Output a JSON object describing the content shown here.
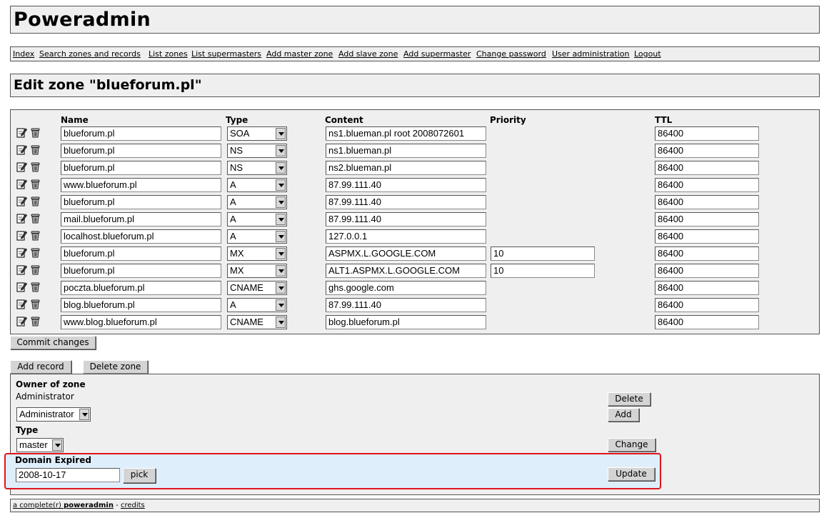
{
  "app": {
    "title": "Poweradmin"
  },
  "menu": [
    {
      "label": "Index"
    },
    {
      "label": "Search zones and records"
    },
    {
      "label": "List zones"
    },
    {
      "label": "List supermasters"
    },
    {
      "label": "Add master zone"
    },
    {
      "label": "Add slave zone"
    },
    {
      "label": "Add supermaster"
    },
    {
      "label": "Change password"
    },
    {
      "label": "User administration"
    },
    {
      "label": "Logout"
    }
  ],
  "page": {
    "title": "Edit zone \"blueforum.pl\""
  },
  "table": {
    "headers": {
      "name": "Name",
      "type": "Type",
      "content": "Content",
      "priority": "Priority",
      "ttl": "TTL"
    },
    "icons": {
      "edit": "edit-icon",
      "delete": "trash-icon"
    },
    "rows": [
      {
        "name": "blueforum.pl",
        "type": "SOA",
        "content": "ns1.blueman.pl root 2008072601",
        "priority": "",
        "ttl": "86400"
      },
      {
        "name": "blueforum.pl",
        "type": "NS",
        "content": "ns1.blueman.pl",
        "priority": "",
        "ttl": "86400"
      },
      {
        "name": "blueforum.pl",
        "type": "NS",
        "content": "ns2.blueman.pl",
        "priority": "",
        "ttl": "86400"
      },
      {
        "name": "www.blueforum.pl",
        "type": "A",
        "content": "87.99.111.40",
        "priority": "",
        "ttl": "86400"
      },
      {
        "name": "blueforum.pl",
        "type": "A",
        "content": "87.99.111.40",
        "priority": "",
        "ttl": "86400"
      },
      {
        "name": "mail.blueforum.pl",
        "type": "A",
        "content": "87.99.111.40",
        "priority": "",
        "ttl": "86400"
      },
      {
        "name": "localhost.blueforum.pl",
        "type": "A",
        "content": "127.0.0.1",
        "priority": "",
        "ttl": "86400"
      },
      {
        "name": "blueforum.pl",
        "type": "MX",
        "content": "ASPMX.L.GOOGLE.COM",
        "priority": "10",
        "ttl": "86400"
      },
      {
        "name": "blueforum.pl",
        "type": "MX",
        "content": "ALT1.ASPMX.L.GOOGLE.COM",
        "priority": "10",
        "ttl": "86400"
      },
      {
        "name": "poczta.blueforum.pl",
        "type": "CNAME",
        "content": "ghs.google.com",
        "priority": "",
        "ttl": "86400"
      },
      {
        "name": "blog.blueforum.pl",
        "type": "A",
        "content": "87.99.111.40",
        "priority": "",
        "ttl": "86400"
      },
      {
        "name": "www.blog.blueforum.pl",
        "type": "CNAME",
        "content": "blog.blueforum.pl",
        "priority": "",
        "ttl": "86400"
      }
    ],
    "commit_label": "Commit changes"
  },
  "actions": {
    "add_record": "Add record",
    "delete_zone": "Delete zone"
  },
  "owner": {
    "heading": "Owner of zone",
    "current": "Administrator",
    "select_value": "Administrator",
    "delete_label": "Delete",
    "add_label": "Add"
  },
  "type_section": {
    "heading": "Type",
    "value": "master",
    "change_label": "Change"
  },
  "expired": {
    "heading": "Domain Expired",
    "value": "2008-10-17",
    "pick_label": "pick",
    "update_label": "Update",
    "highlight_color": "#e0141c"
  },
  "footer": {
    "prefix": "a complete(r)",
    "brand": "poweradmin",
    "sep": "-",
    "credits": "credits"
  }
}
